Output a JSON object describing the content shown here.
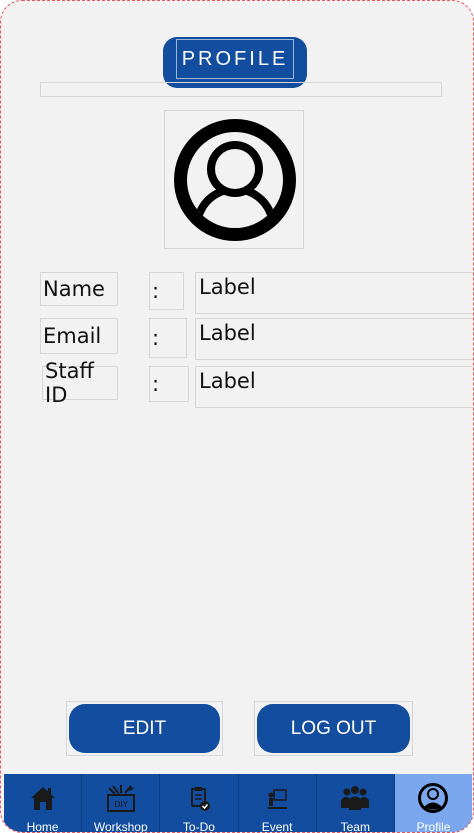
{
  "header": {
    "title": "PROFILE"
  },
  "fields": [
    {
      "label": "Name",
      "colon": ":",
      "value": "Label"
    },
    {
      "label": "Email",
      "colon": ":",
      "value": "Label"
    },
    {
      "label": "Staff ID",
      "colon": ":",
      "value": "Label"
    }
  ],
  "actions": {
    "edit_label": "EDIT",
    "logout_label": "LOG OUT"
  },
  "nav": {
    "items": [
      {
        "label": "Home",
        "icon": "home-icon"
      },
      {
        "label": "Workshop",
        "icon": "diy-tools-icon"
      },
      {
        "label": "To-Do",
        "icon": "clipboard-check-icon"
      },
      {
        "label": "Event",
        "icon": "presentation-icon"
      },
      {
        "label": "Team",
        "icon": "group-icon"
      },
      {
        "label": "Profile",
        "icon": "user-circle-icon",
        "active": true
      }
    ]
  },
  "colors": {
    "primary": "#124da0",
    "active_tab": "#7aa7ee",
    "background": "#f2f2f2"
  }
}
